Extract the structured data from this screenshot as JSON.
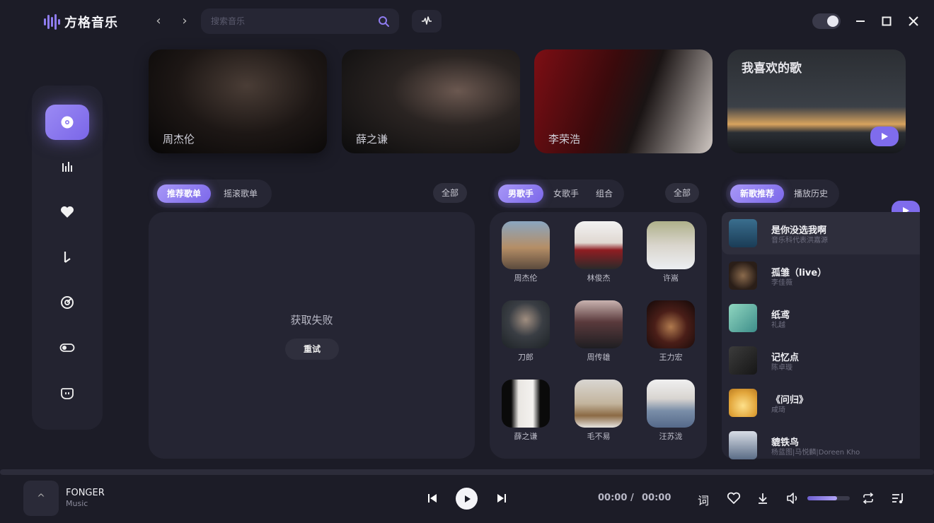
{
  "app": {
    "title": "方格音乐"
  },
  "search": {
    "placeholder": "搜索音乐"
  },
  "banners": [
    {
      "label": "周杰伦"
    },
    {
      "label": "薛之谦"
    },
    {
      "label": "李荣浩"
    },
    {
      "label": "我喜欢的歌"
    }
  ],
  "playlists": {
    "tabs": [
      "推荐歌单",
      "摇滚歌单"
    ],
    "active_tab": "推荐歌单",
    "all_label": "全部",
    "error_text": "获取失败",
    "retry_label": "重试"
  },
  "singers": {
    "tabs": [
      "男歌手",
      "女歌手",
      "组合"
    ],
    "active_tab": "男歌手",
    "all_label": "全部",
    "items": [
      {
        "name": "周杰伦"
      },
      {
        "name": "林俊杰"
      },
      {
        "name": "许嵩"
      },
      {
        "name": "刀郎"
      },
      {
        "name": "周传雄"
      },
      {
        "name": "王力宏"
      },
      {
        "name": "薛之谦"
      },
      {
        "name": "毛不易"
      },
      {
        "name": "汪苏泷"
      }
    ]
  },
  "songs": {
    "tabs": [
      "新歌推荐",
      "播放历史"
    ],
    "active_tab": "新歌推荐",
    "items": [
      {
        "title": "是你没选我啊",
        "artist": "音乐科代表洪嘉源"
      },
      {
        "title": "孤雏（live）",
        "artist": "李佳薇"
      },
      {
        "title": "纸鸢",
        "artist": "礼越"
      },
      {
        "title": "记忆点",
        "artist": "陈卓璇"
      },
      {
        "title": "《问归》",
        "artist": "咸琦"
      },
      {
        "title": "貔铁鸟",
        "artist": "杨蓝图|马悦麟|Doreen Kho"
      }
    ]
  },
  "player": {
    "track_title": "FONGER",
    "track_artist": "Music",
    "current_time": "00:00",
    "time_separator": "/",
    "total_time": "00:00",
    "lyrics_label": "词",
    "mini_cover_glyph": "^",
    "volume_fraction": 0.7
  },
  "colors": {
    "accent": "#8f7cf0",
    "background": "#1c1c27",
    "panel": "#252533"
  }
}
